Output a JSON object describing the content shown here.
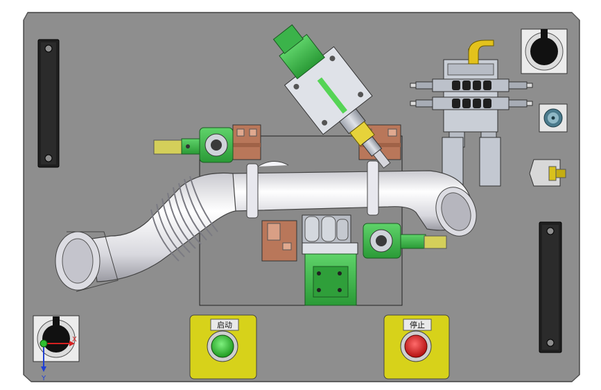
{
  "buttons": {
    "start_label": "启动",
    "stop_label": "停止"
  },
  "triad": {
    "x_label": "X",
    "y_label": "Y"
  },
  "colors": {
    "base_plate": "#8e8e8e",
    "clamp_green": "#3bb34a",
    "copper_block": "#b9775a",
    "button_yellow": "#d7d21a",
    "start_green": "#2bbf2b",
    "stop_red": "#d42020",
    "pipe_white": "#ececf0"
  }
}
